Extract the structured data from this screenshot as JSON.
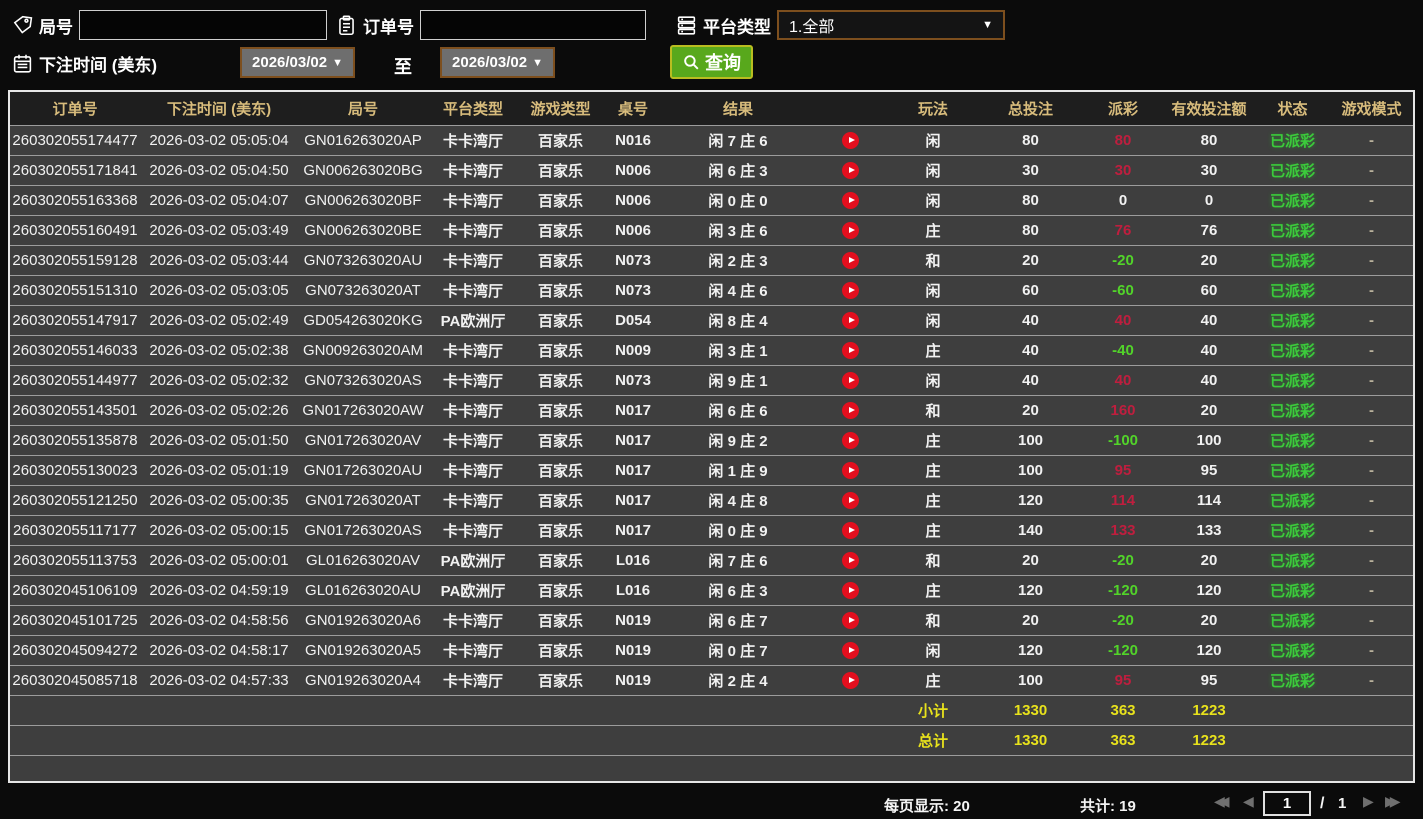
{
  "filters": {
    "game_no_label": "局号",
    "game_no_value": "",
    "order_no_label": "订单号",
    "order_no_value": "",
    "platform_label": "平台类型",
    "platform_value": "1.全部",
    "bet_time_label": "下注时间 (美东)",
    "date_from": "2026/03/02",
    "to_label": "至",
    "date_to": "2026/03/02",
    "query_label": "查询"
  },
  "table": {
    "headers": [
      "订单号",
      "下注时间 (美东)",
      "局号",
      "平台类型",
      "游戏类型",
      "桌号",
      "结果",
      "",
      "玩法",
      "总投注",
      "派彩",
      "有效投注额",
      "状态",
      "游戏模式"
    ],
    "rows": [
      {
        "order_no": "260302055174477",
        "bet_time": "2026-03-02 05:05:04",
        "game_no": "GN016263020AP",
        "platform": "卡卡湾厅",
        "game_type": "百家乐",
        "table_no": "N016",
        "result": "闲 7 庄 6",
        "bet_on": "闲",
        "total_bet": "80",
        "payout": "80",
        "valid_bet": "80",
        "status": "已派彩",
        "mode": "-"
      },
      {
        "order_no": "260302055171841",
        "bet_time": "2026-03-02 05:04:50",
        "game_no": "GN006263020BG",
        "platform": "卡卡湾厅",
        "game_type": "百家乐",
        "table_no": "N006",
        "result": "闲 6 庄 3",
        "bet_on": "闲",
        "total_bet": "30",
        "payout": "30",
        "valid_bet": "30",
        "status": "已派彩",
        "mode": "-"
      },
      {
        "order_no": "260302055163368",
        "bet_time": "2026-03-02 05:04:07",
        "game_no": "GN006263020BF",
        "platform": "卡卡湾厅",
        "game_type": "百家乐",
        "table_no": "N006",
        "result": "闲 0 庄 0",
        "bet_on": "闲",
        "total_bet": "80",
        "payout": "0",
        "valid_bet": "0",
        "status": "已派彩",
        "mode": "-"
      },
      {
        "order_no": "260302055160491",
        "bet_time": "2026-03-02 05:03:49",
        "game_no": "GN006263020BE",
        "platform": "卡卡湾厅",
        "game_type": "百家乐",
        "table_no": "N006",
        "result": "闲 3 庄 6",
        "bet_on": "庄",
        "total_bet": "80",
        "payout": "76",
        "valid_bet": "76",
        "status": "已派彩",
        "mode": "-"
      },
      {
        "order_no": "260302055159128",
        "bet_time": "2026-03-02 05:03:44",
        "game_no": "GN073263020AU",
        "platform": "卡卡湾厅",
        "game_type": "百家乐",
        "table_no": "N073",
        "result": "闲 2 庄 3",
        "bet_on": "和",
        "total_bet": "20",
        "payout": "-20",
        "valid_bet": "20",
        "status": "已派彩",
        "mode": "-"
      },
      {
        "order_no": "260302055151310",
        "bet_time": "2026-03-02 05:03:05",
        "game_no": "GN073263020AT",
        "platform": "卡卡湾厅",
        "game_type": "百家乐",
        "table_no": "N073",
        "result": "闲 4 庄 6",
        "bet_on": "闲",
        "total_bet": "60",
        "payout": "-60",
        "valid_bet": "60",
        "status": "已派彩",
        "mode": "-"
      },
      {
        "order_no": "260302055147917",
        "bet_time": "2026-03-02 05:02:49",
        "game_no": "GD054263020KG",
        "platform": "PA欧洲厅",
        "game_type": "百家乐",
        "table_no": "D054",
        "result": "闲 8 庄 4",
        "bet_on": "闲",
        "total_bet": "40",
        "payout": "40",
        "valid_bet": "40",
        "status": "已派彩",
        "mode": "-"
      },
      {
        "order_no": "260302055146033",
        "bet_time": "2026-03-02 05:02:38",
        "game_no": "GN009263020AM",
        "platform": "卡卡湾厅",
        "game_type": "百家乐",
        "table_no": "N009",
        "result": "闲 3 庄 1",
        "bet_on": "庄",
        "total_bet": "40",
        "payout": "-40",
        "valid_bet": "40",
        "status": "已派彩",
        "mode": "-"
      },
      {
        "order_no": "260302055144977",
        "bet_time": "2026-03-02 05:02:32",
        "game_no": "GN073263020AS",
        "platform": "卡卡湾厅",
        "game_type": "百家乐",
        "table_no": "N073",
        "result": "闲 9 庄 1",
        "bet_on": "闲",
        "total_bet": "40",
        "payout": "40",
        "valid_bet": "40",
        "status": "已派彩",
        "mode": "-"
      },
      {
        "order_no": "260302055143501",
        "bet_time": "2026-03-02 05:02:26",
        "game_no": "GN017263020AW",
        "platform": "卡卡湾厅",
        "game_type": "百家乐",
        "table_no": "N017",
        "result": "闲 6 庄 6",
        "bet_on": "和",
        "total_bet": "20",
        "payout": "160",
        "valid_bet": "20",
        "status": "已派彩",
        "mode": "-"
      },
      {
        "order_no": "260302055135878",
        "bet_time": "2026-03-02 05:01:50",
        "game_no": "GN017263020AV",
        "platform": "卡卡湾厅",
        "game_type": "百家乐",
        "table_no": "N017",
        "result": "闲 9 庄 2",
        "bet_on": "庄",
        "total_bet": "100",
        "payout": "-100",
        "valid_bet": "100",
        "status": "已派彩",
        "mode": "-"
      },
      {
        "order_no": "260302055130023",
        "bet_time": "2026-03-02 05:01:19",
        "game_no": "GN017263020AU",
        "platform": "卡卡湾厅",
        "game_type": "百家乐",
        "table_no": "N017",
        "result": "闲 1 庄 9",
        "bet_on": "庄",
        "total_bet": "100",
        "payout": "95",
        "valid_bet": "95",
        "status": "已派彩",
        "mode": "-"
      },
      {
        "order_no": "260302055121250",
        "bet_time": "2026-03-02 05:00:35",
        "game_no": "GN017263020AT",
        "platform": "卡卡湾厅",
        "game_type": "百家乐",
        "table_no": "N017",
        "result": "闲 4 庄 8",
        "bet_on": "庄",
        "total_bet": "120",
        "payout": "114",
        "valid_bet": "114",
        "status": "已派彩",
        "mode": "-"
      },
      {
        "order_no": "260302055117177",
        "bet_time": "2026-03-02 05:00:15",
        "game_no": "GN017263020AS",
        "platform": "卡卡湾厅",
        "game_type": "百家乐",
        "table_no": "N017",
        "result": "闲 0 庄 9",
        "bet_on": "庄",
        "total_bet": "140",
        "payout": "133",
        "valid_bet": "133",
        "status": "已派彩",
        "mode": "-"
      },
      {
        "order_no": "260302055113753",
        "bet_time": "2026-03-02 05:00:01",
        "game_no": "GL016263020AV",
        "platform": "PA欧洲厅",
        "game_type": "百家乐",
        "table_no": "L016",
        "result": "闲 7 庄 6",
        "bet_on": "和",
        "total_bet": "20",
        "payout": "-20",
        "valid_bet": "20",
        "status": "已派彩",
        "mode": "-"
      },
      {
        "order_no": "260302045106109",
        "bet_time": "2026-03-02 04:59:19",
        "game_no": "GL016263020AU",
        "platform": "PA欧洲厅",
        "game_type": "百家乐",
        "table_no": "L016",
        "result": "闲 6 庄 3",
        "bet_on": "庄",
        "total_bet": "120",
        "payout": "-120",
        "valid_bet": "120",
        "status": "已派彩",
        "mode": "-"
      },
      {
        "order_no": "260302045101725",
        "bet_time": "2026-03-02 04:58:56",
        "game_no": "GN019263020A6",
        "platform": "卡卡湾厅",
        "game_type": "百家乐",
        "table_no": "N019",
        "result": "闲 6 庄 7",
        "bet_on": "和",
        "total_bet": "20",
        "payout": "-20",
        "valid_bet": "20",
        "status": "已派彩",
        "mode": "-"
      },
      {
        "order_no": "260302045094272",
        "bet_time": "2026-03-02 04:58:17",
        "game_no": "GN019263020A5",
        "platform": "卡卡湾厅",
        "game_type": "百家乐",
        "table_no": "N019",
        "result": "闲 0 庄 7",
        "bet_on": "闲",
        "total_bet": "120",
        "payout": "-120",
        "valid_bet": "120",
        "status": "已派彩",
        "mode": "-"
      },
      {
        "order_no": "260302045085718",
        "bet_time": "2026-03-02 04:57:33",
        "game_no": "GN019263020A4",
        "platform": "卡卡湾厅",
        "game_type": "百家乐",
        "table_no": "N019",
        "result": "闲 2 庄 4",
        "bet_on": "庄",
        "total_bet": "100",
        "payout": "95",
        "valid_bet": "95",
        "status": "已派彩",
        "mode": "-"
      }
    ],
    "subtotal": {
      "label": "小计",
      "total_bet": "1330",
      "payout": "363",
      "valid_bet": "1223"
    },
    "total": {
      "label": "总计",
      "total_bet": "1330",
      "payout": "363",
      "valid_bet": "1223"
    }
  },
  "pagination": {
    "per_page_label": "每页显示:",
    "per_page": "20",
    "total_label": "共计:",
    "total_count": "19",
    "current_page": "1",
    "page_separator": "/",
    "total_pages": "1"
  },
  "colors": {
    "payout_positive": "#bf1e3e",
    "payout_negative": "#52d42a",
    "status_paid": "#3bcb3b",
    "header_text": "#d8bc7c",
    "sum_text": "#e8e21c",
    "query_button_bg": "#58a81c",
    "row_bg": "#3e3e3e"
  }
}
